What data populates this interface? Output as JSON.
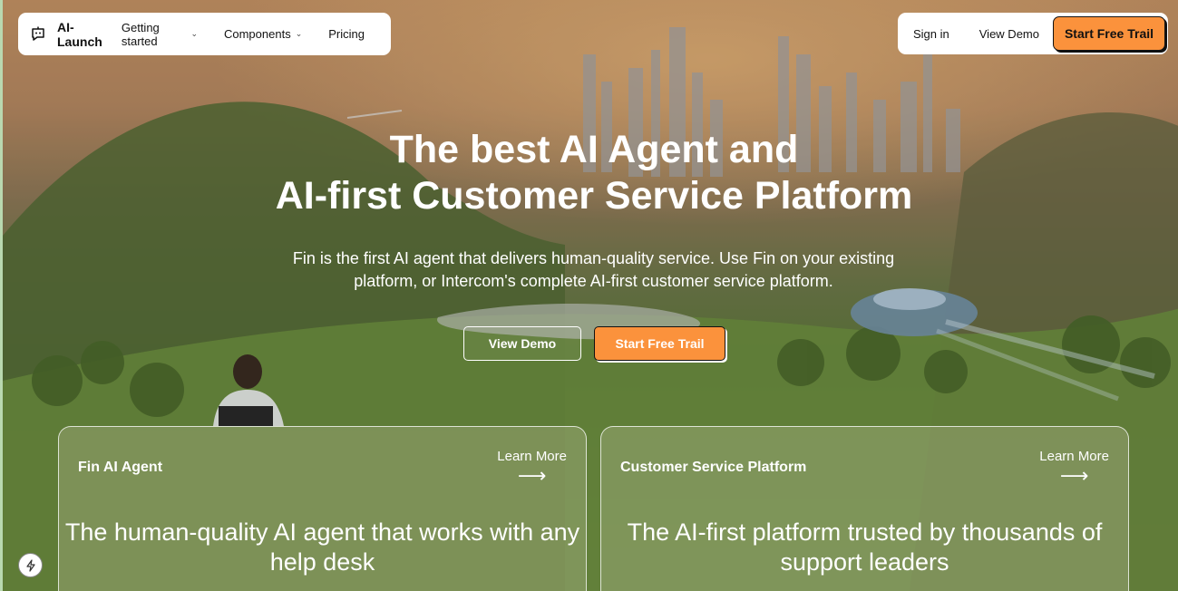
{
  "nav": {
    "brand": "AI-Launch",
    "links": [
      {
        "label": "Getting started",
        "has_dropdown": true
      },
      {
        "label": "Components",
        "has_dropdown": true
      },
      {
        "label": "Pricing",
        "has_dropdown": false
      }
    ],
    "sign_in": "Sign in",
    "view_demo": "View Demo",
    "start_trial": "Start Free Trail"
  },
  "hero": {
    "headline_line1": "The best AI Agent and",
    "headline_line2": "AI-first Customer Service Platform",
    "subtext": "Fin is the first AI agent that delivers human-quality service. Use Fin on your existing platform, or Intercom's complete AI-first customer service platform.",
    "cta_demo": "View Demo",
    "cta_trial": "Start Free Trail"
  },
  "cards": [
    {
      "title": "Fin AI Agent",
      "learn_more": "Learn More",
      "arrow": "⟶",
      "description": "The human-quality AI agent that works with any help desk"
    },
    {
      "title": "Customer Service Platform",
      "learn_more": "Learn More",
      "arrow": "⟶",
      "description": "The AI-first platform trusted by thousands of support leaders"
    }
  ],
  "icons": {
    "logo": "chat-bot-icon",
    "dropdown": "chevron-down-icon",
    "arrow": "arrow-right-icon",
    "floating": "lightning-bolt-icon"
  },
  "colors": {
    "accent": "#fb923c",
    "text_dark": "#111111",
    "text_light": "#ffffff"
  }
}
